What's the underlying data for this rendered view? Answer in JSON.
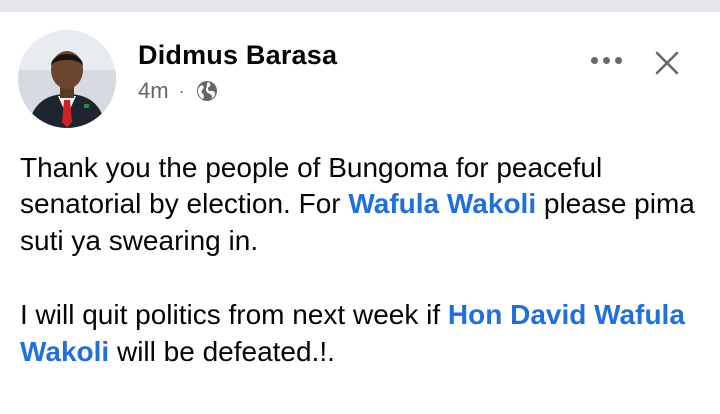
{
  "post": {
    "author": "Didmus Barasa",
    "time": "4m",
    "separator": "·",
    "privacy_icon": "globe-icon",
    "more_icon": "more-options-icon",
    "close_icon": "close-icon",
    "paragraph1": {
      "text1": "Thank you the people of Bungoma for peaceful senatorial by election. For ",
      "tag": "Wafula Wakoli",
      "text2": " please pima suti ya swearing in."
    },
    "paragraph2": {
      "text1": "I will quit politics from next week if ",
      "tag": "Hon David Wafula Wakoli",
      "text2": " will be defeated.!."
    }
  },
  "colors": {
    "tag": "#216fdb",
    "text": "#050505",
    "meta": "#65676b",
    "top_strip": "#e4e6eb"
  }
}
